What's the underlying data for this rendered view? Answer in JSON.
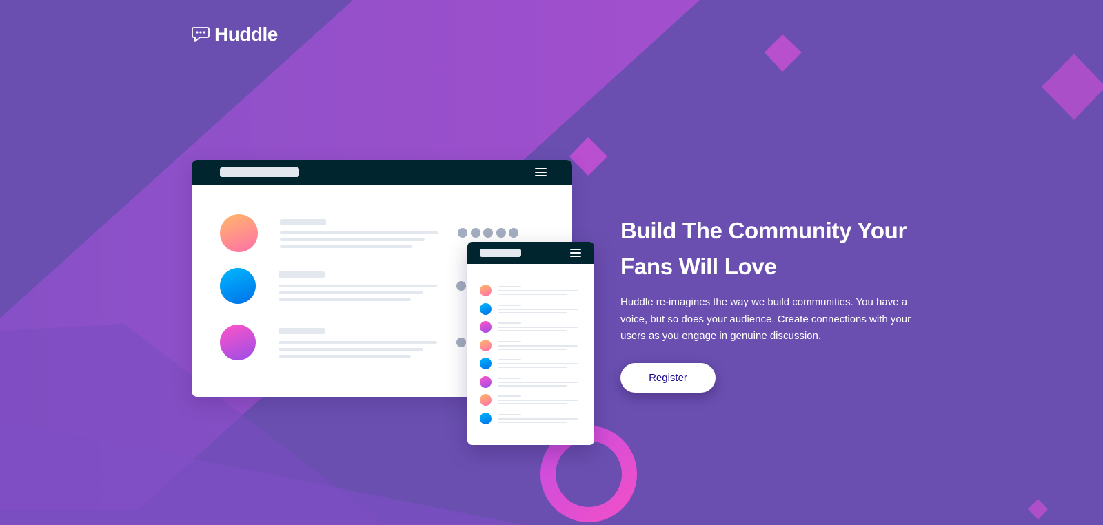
{
  "brand": {
    "name": "Huddle",
    "logo_icon": "chat-bubble-icon"
  },
  "hero": {
    "title": "Build The Community Your Fans Will Love",
    "text": "Huddle re-imagines the way we build communities. You have a voice, but so does your audience. Create connections with your users as you engage in genuine discussion.",
    "cta_label": "Register"
  },
  "illustration": {
    "desktop_menu_icon": "hamburger-menu-icon",
    "mobile_menu_icon": "hamburger-menu-icon"
  },
  "colors": {
    "background": "#6a4fb1",
    "mockup_header": "#00252e",
    "button_text": "#1a0b8f",
    "accent_pink": "#e34bd8",
    "placeholder_gray": "#e3e8ee"
  }
}
